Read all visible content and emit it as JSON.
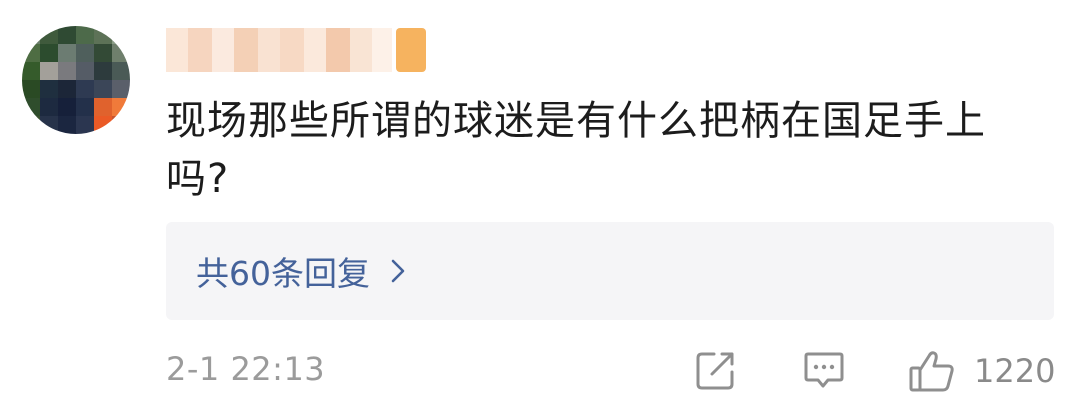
{
  "comment": {
    "username": "",
    "text": "现场那些所谓的球迷是有什么把柄在国足手上吗?",
    "reply_link_label": "共60条回复",
    "timestamp": "2-1 22:13",
    "like_count": "1220"
  },
  "icons": {
    "share": "share-icon",
    "comment": "comment-icon",
    "like": "thumbs-up-icon",
    "reply_chevron": "chevron-right-icon"
  },
  "colors": {
    "link": "#44629a",
    "meta_text": "#9b9b9b",
    "reply_bg": "#f5f5f7"
  }
}
